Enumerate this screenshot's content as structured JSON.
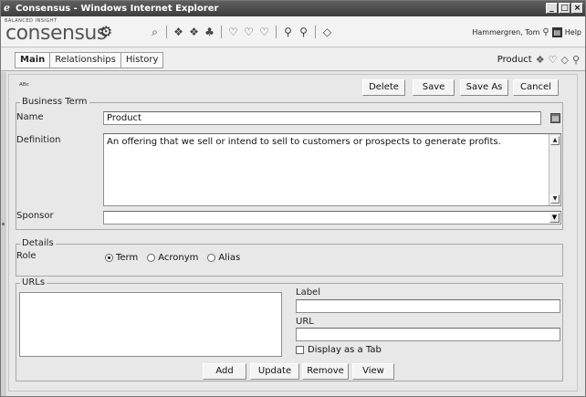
{
  "window": {
    "title": "Consensus - Windows Internet Explorer",
    "controls": [
      "_",
      "□",
      "×"
    ]
  },
  "brand": {
    "tagline": "BALANCED INSIGHT",
    "name": "consensus"
  },
  "toolbar_icons": [
    "scope-icon",
    "find-term-icon",
    "term-icon",
    "find-icon",
    "relationship-icon",
    "approve-icon",
    "review-icon",
    "search-user-icon",
    "search-group-icon",
    "link-icon"
  ],
  "user": {
    "name": "Hammergren, Tom",
    "help": "Help"
  },
  "tabs": [
    {
      "label": "Main"
    },
    {
      "label": "Relationships"
    },
    {
      "label": "History"
    }
  ],
  "context": {
    "label": "Product"
  },
  "actions": {
    "delete": "Delete",
    "save": "Save",
    "save_as": "Save As",
    "cancel": "Cancel"
  },
  "business_term": {
    "legend": "Business Term",
    "name_label": "Name",
    "name_value": "Product",
    "definition_label": "Definition",
    "definition_value": "An offering that we sell or intend to sell to customers or prospects to generate profits.",
    "sponsor_label": "Sponsor",
    "sponsor_value": ""
  },
  "details": {
    "legend": "Details",
    "role_label": "Role",
    "role_options": [
      "Term",
      "Acronym",
      "Alias"
    ],
    "role_selected": "Term"
  },
  "urls": {
    "legend": "URLs",
    "label_label": "Label",
    "label_value": "",
    "url_label": "URL",
    "url_value": "",
    "display_tab_label": "Display as a Tab",
    "display_tab_checked": false,
    "add": "Add",
    "update": "Update",
    "remove": "Remove",
    "view": "View"
  }
}
